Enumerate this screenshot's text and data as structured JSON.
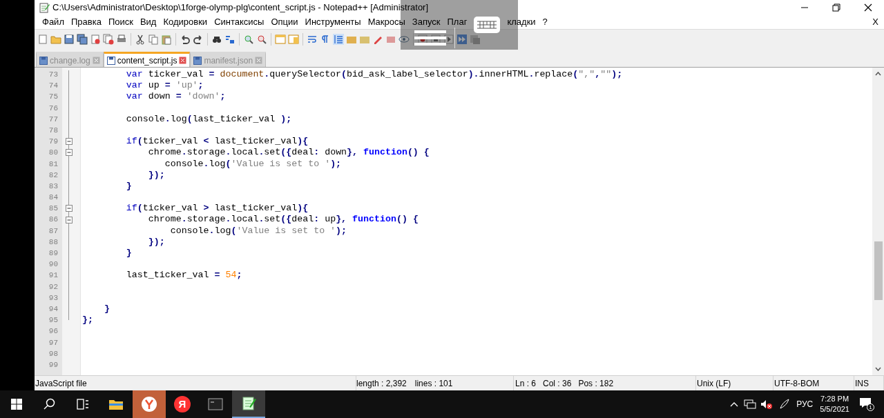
{
  "window": {
    "title": "C:\\Users\\Administrator\\Desktop\\1forge-olymp-plg\\content_script.js - Notepad++ [Administrator]"
  },
  "menu": [
    "Файл",
    "Правка",
    "Поиск",
    "Вид",
    "Кодировки",
    "Синтаксисы",
    "Опции",
    "Инструменты",
    "Макросы",
    "Запуск",
    "Плаг",
    "кладки",
    "?"
  ],
  "menu_close": "X",
  "tabs": [
    {
      "label": "change.log",
      "selected": false
    },
    {
      "label": "content_script.js",
      "selected": true
    },
    {
      "label": "manifest.json",
      "selected": false
    }
  ],
  "editor": {
    "lines": [
      {
        "number": "73",
        "foldable": false,
        "tokens": [
          {
            "kind": "keyword",
            "text": "        var"
          },
          {
            "kind": "plain",
            "text": " ticker_val "
          },
          {
            "kind": "op",
            "text": "= "
          },
          {
            "kind": "object",
            "text": "document"
          },
          {
            "kind": "op",
            "text": "."
          },
          {
            "kind": "plain",
            "text": "querySelector"
          },
          {
            "kind": "op",
            "text": "("
          },
          {
            "kind": "plain",
            "text": "bid_ask_label_selector"
          },
          {
            "kind": "op",
            "text": ")."
          },
          {
            "kind": "plain",
            "text": "innerHTML"
          },
          {
            "kind": "op",
            "text": "."
          },
          {
            "kind": "plain",
            "text": "replace"
          },
          {
            "kind": "op",
            "text": "("
          },
          {
            "kind": "string",
            "text": "\",\""
          },
          {
            "kind": "op",
            "text": ","
          },
          {
            "kind": "string",
            "text": "\"\""
          },
          {
            "kind": "op",
            "text": ");"
          }
        ]
      },
      {
        "number": "74",
        "foldable": false,
        "tokens": [
          {
            "kind": "keyword",
            "text": "        var"
          },
          {
            "kind": "plain",
            "text": " up "
          },
          {
            "kind": "op",
            "text": "= "
          },
          {
            "kind": "string",
            "text": "'up'"
          },
          {
            "kind": "op",
            "text": ";"
          }
        ]
      },
      {
        "number": "75",
        "foldable": false,
        "tokens": [
          {
            "kind": "keyword",
            "text": "        var"
          },
          {
            "kind": "plain",
            "text": " down "
          },
          {
            "kind": "op",
            "text": "= "
          },
          {
            "kind": "string",
            "text": "'down'"
          },
          {
            "kind": "op",
            "text": ";"
          }
        ]
      },
      {
        "number": "76",
        "foldable": false
      },
      {
        "number": "77",
        "foldable": false,
        "tokens": [
          {
            "kind": "plain",
            "text": "        console"
          },
          {
            "kind": "op",
            "text": "."
          },
          {
            "kind": "plain",
            "text": "log"
          },
          {
            "kind": "op",
            "text": "("
          },
          {
            "kind": "plain",
            "text": "last_ticker_val "
          },
          {
            "kind": "op",
            "text": ");"
          }
        ]
      },
      {
        "number": "78",
        "foldable": false
      },
      {
        "number": "79",
        "foldable": true,
        "tokens": [
          {
            "kind": "keyword",
            "text": "        if"
          },
          {
            "kind": "op",
            "text": "("
          },
          {
            "kind": "plain",
            "text": "ticker_val "
          },
          {
            "kind": "op",
            "text": "<"
          },
          {
            "kind": "plain",
            "text": " last_ticker_val"
          },
          {
            "kind": "op",
            "text": "){"
          }
        ]
      },
      {
        "number": "80",
        "foldable": true,
        "tokens": [
          {
            "kind": "plain",
            "text": "            chrome"
          },
          {
            "kind": "op",
            "text": "."
          },
          {
            "kind": "plain",
            "text": "storage"
          },
          {
            "kind": "op",
            "text": "."
          },
          {
            "kind": "plain",
            "text": "local"
          },
          {
            "kind": "op",
            "text": "."
          },
          {
            "kind": "plain",
            "text": "set"
          },
          {
            "kind": "op",
            "text": "({"
          },
          {
            "kind": "plain",
            "text": "deal"
          },
          {
            "kind": "op",
            "text": ":"
          },
          {
            "kind": "plain",
            "text": " down"
          },
          {
            "kind": "op",
            "text": "}, "
          },
          {
            "kind": "function",
            "text": "function"
          },
          {
            "kind": "op",
            "text": "() {"
          }
        ]
      },
      {
        "number": "81",
        "foldable": false,
        "tokens": [
          {
            "kind": "plain",
            "text": "               console"
          },
          {
            "kind": "op",
            "text": "."
          },
          {
            "kind": "plain",
            "text": "log"
          },
          {
            "kind": "op",
            "text": "("
          },
          {
            "kind": "string",
            "text": "'Value is set to '"
          },
          {
            "kind": "op",
            "text": ");"
          }
        ]
      },
      {
        "number": "82",
        "foldable": false,
        "tokens": [
          {
            "kind": "op",
            "text": "            });"
          }
        ]
      },
      {
        "number": "83",
        "foldable": false,
        "tokens": [
          {
            "kind": "op",
            "text": "        }"
          }
        ]
      },
      {
        "number": "84",
        "foldable": false
      },
      {
        "number": "85",
        "foldable": true,
        "tokens": [
          {
            "kind": "keyword",
            "text": "        if"
          },
          {
            "kind": "op",
            "text": "("
          },
          {
            "kind": "plain",
            "text": "ticker_val "
          },
          {
            "kind": "op",
            "text": ">"
          },
          {
            "kind": "plain",
            "text": " last_ticker_val"
          },
          {
            "kind": "op",
            "text": "){"
          }
        ]
      },
      {
        "number": "86",
        "foldable": true,
        "tokens": [
          {
            "kind": "plain",
            "text": "            chrome"
          },
          {
            "kind": "op",
            "text": "."
          },
          {
            "kind": "plain",
            "text": "storage"
          },
          {
            "kind": "op",
            "text": "."
          },
          {
            "kind": "plain",
            "text": "local"
          },
          {
            "kind": "op",
            "text": "."
          },
          {
            "kind": "plain",
            "text": "set"
          },
          {
            "kind": "op",
            "text": "({"
          },
          {
            "kind": "plain",
            "text": "deal"
          },
          {
            "kind": "op",
            "text": ":"
          },
          {
            "kind": "plain",
            "text": " up"
          },
          {
            "kind": "op",
            "text": "}, "
          },
          {
            "kind": "function",
            "text": "function"
          },
          {
            "kind": "op",
            "text": "() {"
          }
        ]
      },
      {
        "number": "87",
        "foldable": false,
        "tokens": [
          {
            "kind": "plain",
            "text": "                console"
          },
          {
            "kind": "op",
            "text": "."
          },
          {
            "kind": "plain",
            "text": "log"
          },
          {
            "kind": "op",
            "text": "("
          },
          {
            "kind": "string",
            "text": "'Value is set to '"
          },
          {
            "kind": "op",
            "text": ");"
          }
        ]
      },
      {
        "number": "88",
        "foldable": false,
        "tokens": [
          {
            "kind": "op",
            "text": "            });"
          }
        ]
      },
      {
        "number": "89",
        "foldable": false,
        "tokens": [
          {
            "kind": "op",
            "text": "        }"
          }
        ]
      },
      {
        "number": "90",
        "foldable": false
      },
      {
        "number": "91",
        "foldable": false,
        "tokens": [
          {
            "kind": "plain",
            "text": "        last_ticker_val "
          },
          {
            "kind": "op",
            "text": "= "
          },
          {
            "kind": "number",
            "text": "54"
          },
          {
            "kind": "op",
            "text": ";"
          }
        ]
      },
      {
        "number": "92",
        "foldable": false
      },
      {
        "number": "93",
        "foldable": false
      },
      {
        "number": "94",
        "foldable": false,
        "tokens": [
          {
            "kind": "op",
            "text": "    }"
          }
        ]
      },
      {
        "number": "95",
        "foldable": false,
        "tokens": [
          {
            "kind": "op",
            "text": "};"
          }
        ]
      },
      {
        "number": "96",
        "foldable": false
      },
      {
        "number": "97",
        "foldable": false
      },
      {
        "number": "98",
        "foldable": false
      },
      {
        "number": "99",
        "foldable": false
      }
    ]
  },
  "status_bar": {
    "file_type": "JavaScript file",
    "length": "length : 2,392",
    "lines": "lines : 101",
    "ln": "Ln : 6",
    "col": "Col : 36",
    "pos": "Pos : 182",
    "eol": "Unix (LF)",
    "encoding": "UTF-8-BOM",
    "mode": "INS"
  },
  "taskbar": {
    "yandex_label": "Я",
    "language": "РУС",
    "time": "7:28 PM",
    "date": "5/5/2021",
    "notification_count": "1"
  }
}
